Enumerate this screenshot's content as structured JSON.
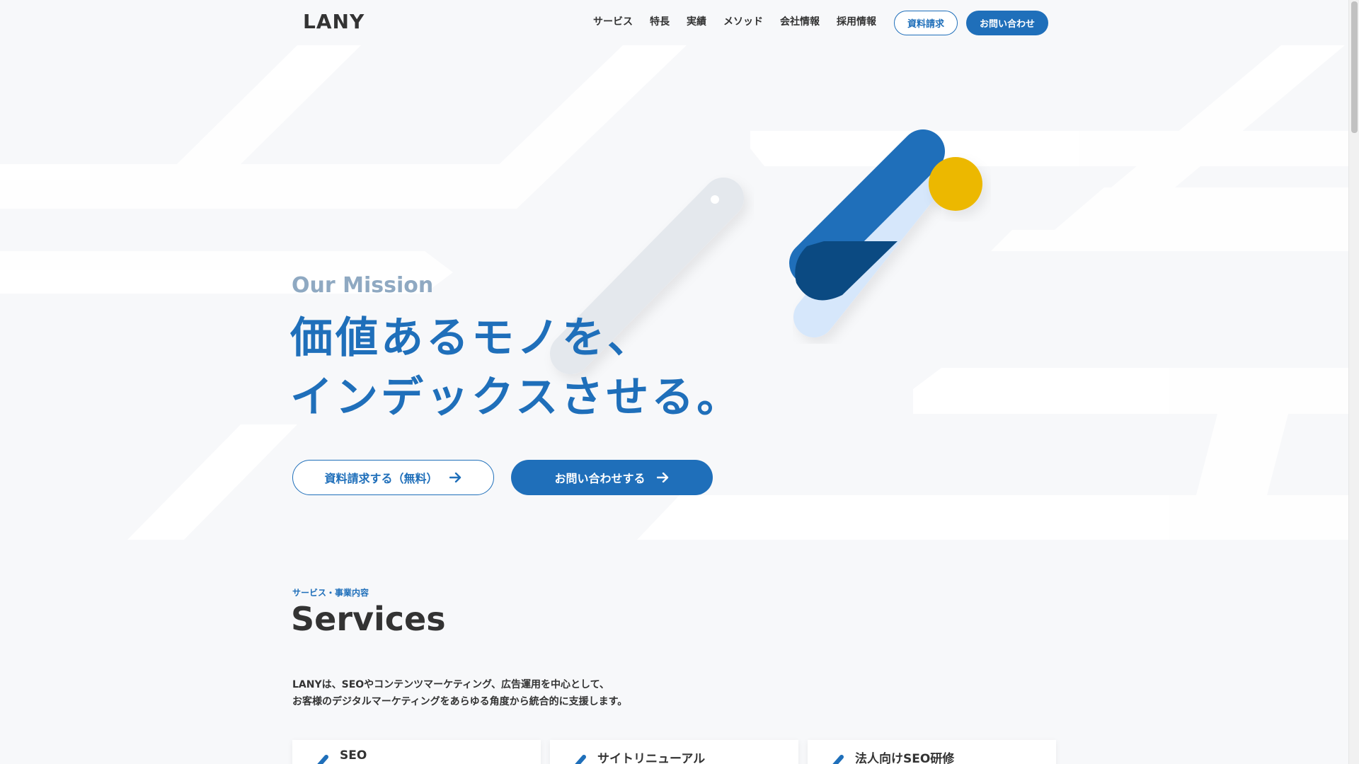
{
  "header": {
    "logo": "LANY",
    "nav": [
      "サービス",
      "特長",
      "実績",
      "メソッド",
      "会社情報",
      "採用情報"
    ],
    "doc_request": "資料請求",
    "contact": "お問い合わせ"
  },
  "hero": {
    "subtitle": "Our Mission",
    "title_line1": "価値あるモノを、",
    "title_line2": "インデックスさせる。",
    "cta_doc": "資料請求する（無料）",
    "cta_contact": "お問い合わせする"
  },
  "services": {
    "label": "サービス・事業内容",
    "title": "Services",
    "desc_line1": "LANYは、SEOやコンテンツマーケティング、広告運用を中心として、",
    "desc_line2": "お客様のデジタルマーケティングをあらゆる角度から統合的に支援します。",
    "cards": [
      "SEO",
      "サイトリニューアル",
      "法人向けSEO研修"
    ]
  },
  "colors": {
    "brand_blue": "#1f6fba",
    "dark_blue": "#0b4a82",
    "light_blue": "#d6e7fb",
    "accent_yellow": "#ecb800",
    "muted_blue": "#8fa9c2"
  },
  "icons": {
    "arrow": "arrow-right-icon",
    "card": "pencil-stroke-icon"
  }
}
